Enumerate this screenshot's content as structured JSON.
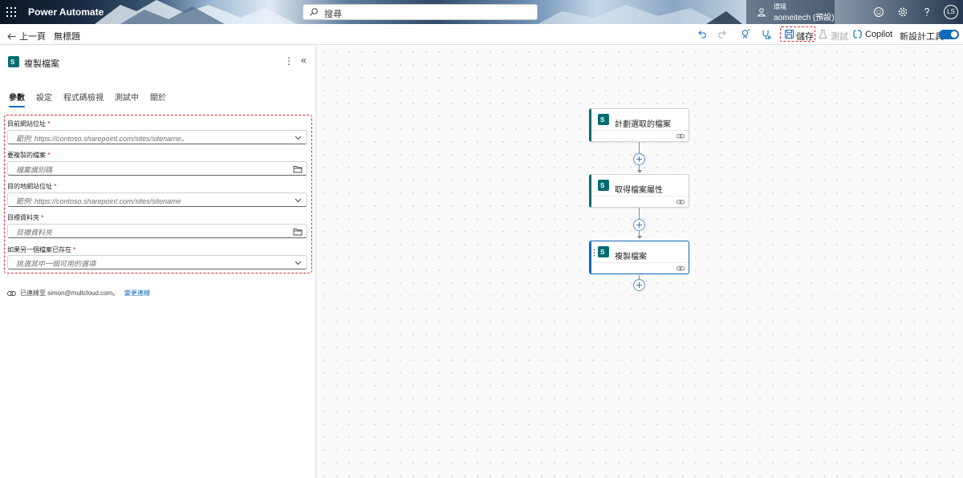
{
  "header": {
    "app_name": "Power Automate",
    "search_placeholder": "搜尋",
    "environment_label": "環境",
    "environment_name": "aomeitech (預設)",
    "avatar_initials": "LS"
  },
  "toolbar": {
    "back_label": "上一頁",
    "flow_title": "無標題",
    "save_label": "儲存",
    "test_label": "測試",
    "copilot_label": "Copilot",
    "new_designer_label": "新設計工具",
    "new_designer_enabled": true
  },
  "panel": {
    "title": "複製檔案",
    "tabs": [
      {
        "label": "參數",
        "active": true
      },
      {
        "label": "設定",
        "active": false
      },
      {
        "label": "程式碼檢視",
        "active": false
      },
      {
        "label": "測試中",
        "active": false
      },
      {
        "label": "關於",
        "active": false
      }
    ],
    "fields": [
      {
        "label": "目前網站位址",
        "required": "*",
        "placeholder": "範例: https://contoso.sharepoint.com/sites/sitename。",
        "kind": "dropdown"
      },
      {
        "label": "要複製的檔案",
        "required": "*",
        "placeholder": "檔案識別碼",
        "kind": "file-picker"
      },
      {
        "label": "目的地網站位址",
        "required": "*",
        "placeholder": "範例: https://contoso.sharepoint.com/sites/sitename",
        "kind": "dropdown"
      },
      {
        "label": "目標資料夾",
        "required": "*",
        "placeholder": "目標資料夾",
        "kind": "file-picker"
      },
      {
        "label": "如果另一個檔案已存在",
        "required": "*",
        "placeholder": "挑選其中一個可用的選項",
        "kind": "dropdown"
      }
    ],
    "connection_text": "已連線至 simon@multcloud.com。",
    "change_connection_label": "變更連線"
  },
  "canvas": {
    "steps": [
      {
        "label": "計劃選取的檔案",
        "selected": false
      },
      {
        "label": "取得檔案屬性",
        "selected": false
      },
      {
        "label": "複製檔案",
        "selected": true
      }
    ]
  },
  "colors": {
    "accent": "#0f6cbd",
    "sharepoint": "#036c70",
    "highlight_red": "#e0282e"
  }
}
